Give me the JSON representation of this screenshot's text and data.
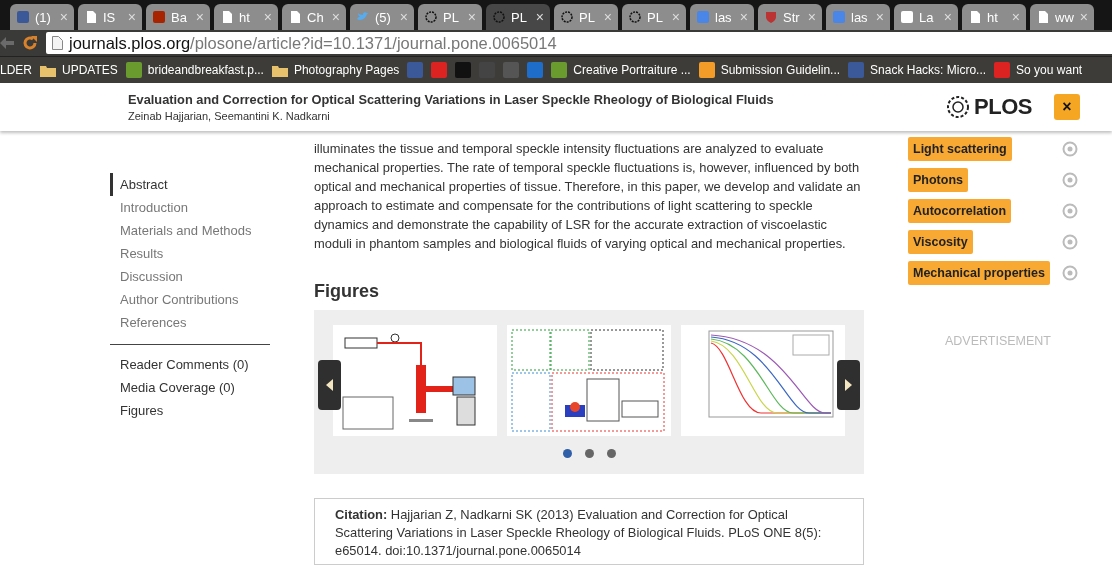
{
  "browser": {
    "tabs": [
      {
        "title": "(1)",
        "kind": "facebook",
        "close": "×",
        "selected": false
      },
      {
        "title": "IS",
        "kind": "page",
        "close": "×",
        "selected": false
      },
      {
        "title": "Ba",
        "kind": "quora",
        "close": "×",
        "selected": false
      },
      {
        "title": "ht",
        "kind": "page",
        "close": "×",
        "selected": false
      },
      {
        "title": "Ch",
        "kind": "page",
        "close": "×",
        "selected": false
      },
      {
        "title": "(5)",
        "kind": "twitter",
        "close": "×",
        "selected": false
      },
      {
        "title": "PL",
        "kind": "plos",
        "close": "×",
        "selected": false
      },
      {
        "title": "PL",
        "kind": "plos",
        "close": "×",
        "selected": true
      },
      {
        "title": "PL",
        "kind": "plos",
        "close": "×",
        "selected": false
      },
      {
        "title": "PL",
        "kind": "plos",
        "close": "×",
        "selected": false
      },
      {
        "title": "las",
        "kind": "google",
        "close": "×",
        "selected": false
      },
      {
        "title": "Str",
        "kind": "crest",
        "close": "×",
        "selected": false
      },
      {
        "title": "las",
        "kind": "google",
        "close": "×",
        "selected": false
      },
      {
        "title": "La",
        "kind": "wiki",
        "close": "×",
        "selected": false
      },
      {
        "title": "ht",
        "kind": "page",
        "close": "×",
        "selected": false
      },
      {
        "title": "ww",
        "kind": "page",
        "close": "×",
        "selected": false
      }
    ],
    "address": {
      "domain": "journals.plos.org",
      "path": "/plosone/article?id=10.1371/journal.pone.0065014"
    },
    "bookmarks": [
      {
        "label": "LDER",
        "kind": "text"
      },
      {
        "label": "UPDATES",
        "kind": "folder"
      },
      {
        "label": "brideandbreakfast.p...",
        "kind": "site"
      },
      {
        "label": "Photography Pages",
        "kind": "folder"
      },
      {
        "kind": "icon"
      },
      {
        "kind": "icon"
      },
      {
        "kind": "icon"
      },
      {
        "kind": "icon"
      },
      {
        "kind": "icon"
      },
      {
        "kind": "icon"
      },
      {
        "label": "Creative Portraiture ...",
        "kind": "site"
      },
      {
        "label": "Submission Guidelin...",
        "kind": "site"
      },
      {
        "label": "Snack Hacks: Micro...",
        "kind": "site"
      },
      {
        "label": "So you want",
        "kind": "site"
      }
    ]
  },
  "header": {
    "title": "Evaluation and Correction for Optical Scattering Variations in Laser Speckle Rheology of Biological Fluids",
    "authors": "Zeinab Hajjarian,  Seemantini K. Nadkarni",
    "logo": "PLOS",
    "close": "×"
  },
  "nav": {
    "sections": [
      {
        "label": "Abstract",
        "selected": true
      },
      {
        "label": "Introduction",
        "selected": false
      },
      {
        "label": "Materials and Methods",
        "selected": false
      },
      {
        "label": "Results",
        "selected": false
      },
      {
        "label": "Discussion",
        "selected": false
      },
      {
        "label": "Author Contributions",
        "selected": false
      },
      {
        "label": "References",
        "selected": false
      }
    ],
    "extras": [
      "Reader Comments (0)",
      "Media Coverage (0)",
      "Figures"
    ]
  },
  "abstract_text": "illuminates the tissue and temporal speckle intensity fluctuations are analyzed to evaluate mechanical properties. The rate of temporal speckle fluctuations is, however, influenced by both optical and mechanical properties of tissue. Therefore, in this paper, we develop and validate an approach to estimate and compensate for the contributions of light scattering to speckle dynamics and demonstrate the capability of LSR for the accurate extraction of viscoelastic moduli in phantom samples and biological fluids of varying optical and mechanical properties.",
  "figures": {
    "heading": "Figures",
    "dots": [
      {
        "selected": true
      },
      {
        "selected": false
      },
      {
        "selected": false
      }
    ]
  },
  "citation": "**Citation:** Hajjarian Z, Nadkarni SK (2013) Evaluation and Correction for Optical Scattering Variations in Laser Speckle Rheology of Biological Fluids. PLoS ONE 8(5): e65014. doi:10.1371/journal.pone.0065014",
  "keywords": [
    "Light scattering",
    "Photons",
    "Autocorrelation",
    "Viscosity",
    "Mechanical properties"
  ],
  "advertisement": "ADVERTISEMENT"
}
